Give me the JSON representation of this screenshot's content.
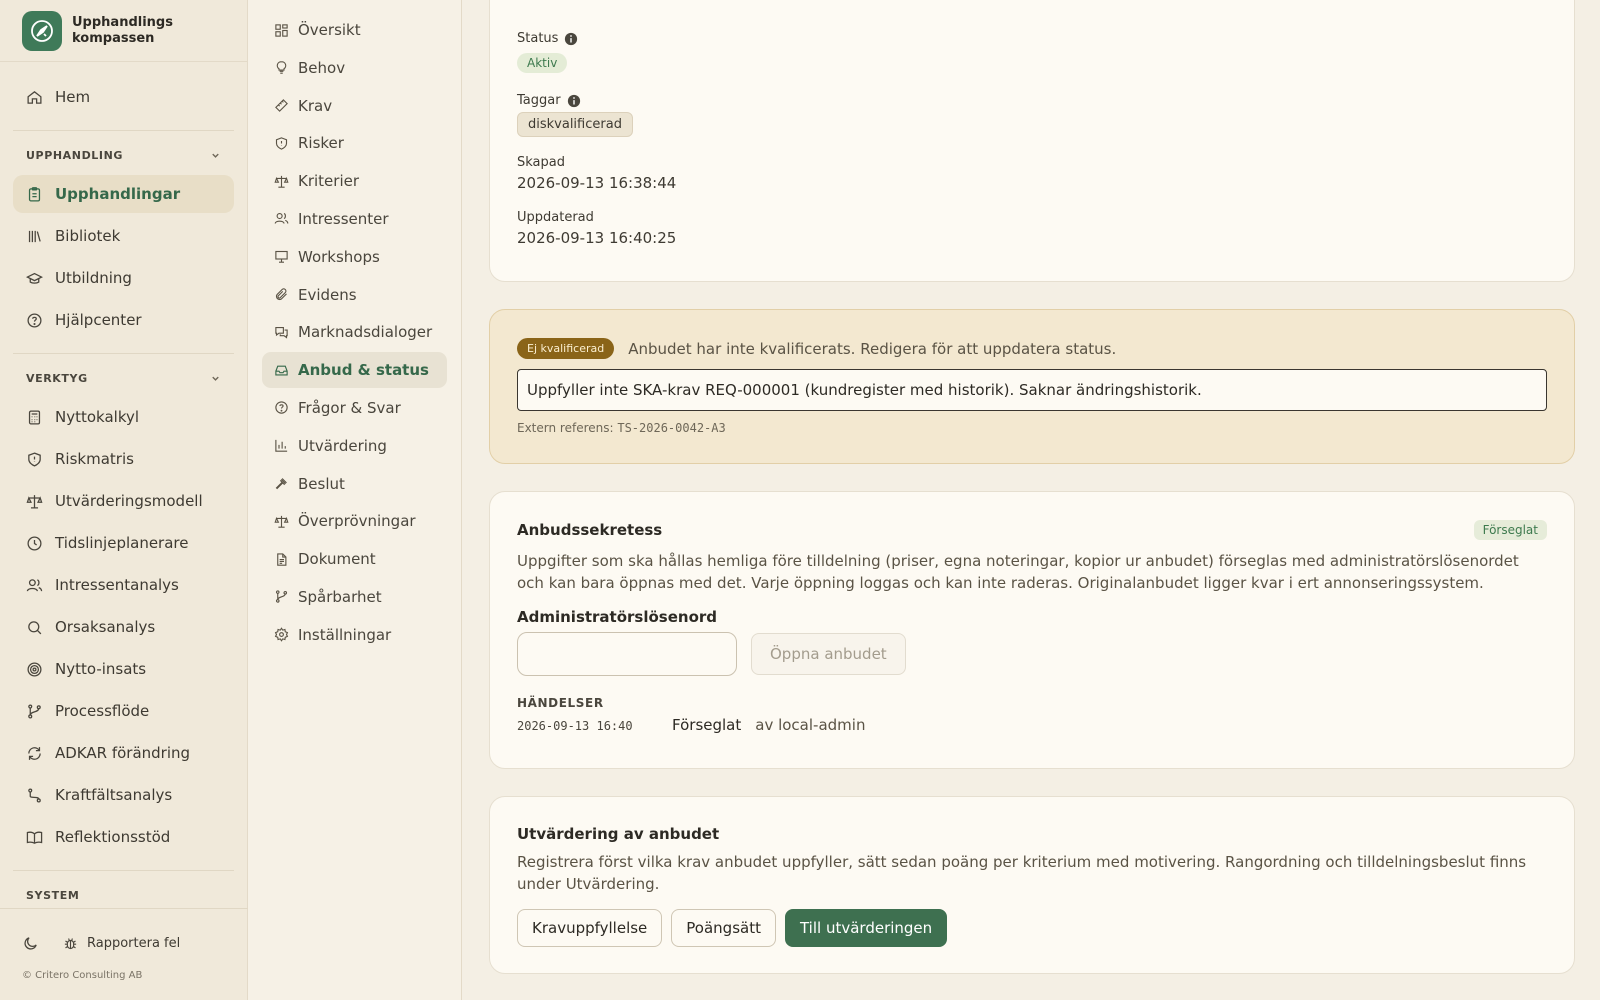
{
  "brand": {
    "line1": "Upphandlings",
    "line2": "kompassen"
  },
  "colors": {
    "accent": "#3e7050",
    "background": "#f4efe4",
    "warning": "#8a6418"
  },
  "sidebar": {
    "home": {
      "label": "Hem",
      "icon": "home-icon"
    },
    "section_procurement": "UPPHANDLING",
    "procurement_items": [
      {
        "label": "Upphandlingar",
        "icon": "clipboard-icon",
        "active": true
      },
      {
        "label": "Bibliotek",
        "icon": "library-icon"
      },
      {
        "label": "Utbildning",
        "icon": "graduation-cap-icon"
      },
      {
        "label": "Hjälpcenter",
        "icon": "help-circle-icon"
      }
    ],
    "section_tools": "VERKTYG",
    "tool_items": [
      {
        "label": "Nyttokalkyl",
        "icon": "calculator-icon"
      },
      {
        "label": "Riskmatris",
        "icon": "shield-icon"
      },
      {
        "label": "Utvärderingsmodell",
        "icon": "scale-icon"
      },
      {
        "label": "Tidslinjeplanerare",
        "icon": "clock-icon"
      },
      {
        "label": "Intressentanalys",
        "icon": "users-icon"
      },
      {
        "label": "Orsaksanalys",
        "icon": "search-icon"
      },
      {
        "label": "Nytto-insats",
        "icon": "target-icon"
      },
      {
        "label": "Processflöde",
        "icon": "git-branch-icon"
      },
      {
        "label": "ADKAR förändring",
        "icon": "refresh-icon"
      },
      {
        "label": "Kraftfältsanalys",
        "icon": "route-icon"
      },
      {
        "label": "Reflektionsstöd",
        "icon": "book-open-icon"
      }
    ],
    "section_system": "SYSTEM",
    "report_bug": "Rapportera fel",
    "copyright": "© Critero Consulting AB"
  },
  "subnav": {
    "items": [
      {
        "label": "Översikt",
        "icon": "grid-icon"
      },
      {
        "label": "Behov",
        "icon": "lightbulb-icon"
      },
      {
        "label": "Krav",
        "icon": "ruler-icon"
      },
      {
        "label": "Risker",
        "icon": "shield-icon"
      },
      {
        "label": "Kriterier",
        "icon": "scale-icon"
      },
      {
        "label": "Intressenter",
        "icon": "users-icon"
      },
      {
        "label": "Workshops",
        "icon": "presentation-icon"
      },
      {
        "label": "Evidens",
        "icon": "paperclip-icon"
      },
      {
        "label": "Marknadsdialoger",
        "icon": "messages-icon"
      },
      {
        "label": "Anbud & status",
        "icon": "inbox-icon",
        "active": true
      },
      {
        "label": "Frågor & Svar",
        "icon": "help-circle-icon"
      },
      {
        "label": "Utvärdering",
        "icon": "bar-chart-icon"
      },
      {
        "label": "Beslut",
        "icon": "gavel-icon"
      },
      {
        "label": "Överprövningar",
        "icon": "scale-icon"
      },
      {
        "label": "Dokument",
        "icon": "file-text-icon"
      },
      {
        "label": "Spårbarhet",
        "icon": "git-branch-icon"
      },
      {
        "label": "Inställningar",
        "icon": "settings-icon"
      }
    ]
  },
  "details": {
    "status_label": "Status",
    "status_value": "Aktiv",
    "tags_label": "Taggar",
    "tag_value": "diskvalificerad",
    "created_label": "Skapad",
    "created_value": "2026-09-13 16:38:44",
    "updated_label": "Uppdaterad",
    "updated_value": "2026-09-13 16:40:25"
  },
  "qualification": {
    "badge": "Ej kvalificerad",
    "message": "Anbudet har inte kvalificerats. Redigera för att uppdatera status.",
    "note": "Uppfyller inte SKA-krav REQ-000001 (kundregister med historik). Saknar ändringshistorik.",
    "ext_ref_label": "Extern referens:",
    "ext_ref_value": "TS-2026-0042-A3"
  },
  "secrecy": {
    "title": "Anbudssekretess",
    "badge": "Förseglat",
    "description": "Uppgifter som ska hållas hemliga före tilldelning (priser, egna noteringar, kopior ur anbudet) förseglas med administratörslösenordet och kan bara öppnas med det. Varje öppning loggas och kan inte raderas. Originalanbudet ligger kvar i ert annonseringssystem.",
    "password_label": "Administratörslösenord",
    "password_value": "",
    "open_button": "Öppna anbudet",
    "events_label": "HÄNDELSER",
    "events": [
      {
        "time": "2026-09-13 16:40",
        "name": "Förseglat",
        "by": "av local-admin"
      }
    ]
  },
  "evaluation": {
    "title": "Utvärdering av anbudet",
    "description": "Registrera först vilka krav anbudet uppfyller, sätt sedan poäng per kriterium med motivering. Rangordning och tilldelningsbeslut finns under Utvärdering.",
    "buttons": [
      "Kravuppfyllelse",
      "Poängsätt",
      "Till utvärderingen"
    ]
  }
}
